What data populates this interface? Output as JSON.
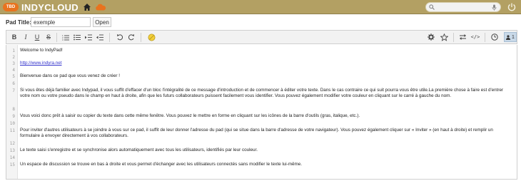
{
  "app": {
    "logo_badge": "TBD",
    "logo_text": "INDYCLOUD",
    "brand_color": "#b3a063",
    "accent_color": "#e8731e"
  },
  "search": {
    "placeholder": ""
  },
  "pad": {
    "title_label": "Pad Title:",
    "title_value": "exemple",
    "open_label": "Open"
  },
  "toolbar": {
    "left_buttons": [
      "bold-icon",
      "italic-icon",
      "underline-icon",
      "strikethrough-icon",
      "ordered-list-icon",
      "unordered-list-icon",
      "indent-icon",
      "outdent-icon",
      "undo-icon",
      "redo-icon",
      "clear-authorship-icon"
    ],
    "right_buttons": [
      "settings-icon",
      "star-icon",
      "import-export-icon",
      "embed-icon",
      "history-icon"
    ],
    "users_count": "1"
  },
  "editor": {
    "lines": [
      {
        "num": "1",
        "text": "Welcome to IndyPad!"
      },
      {
        "num": "2",
        "text": ""
      },
      {
        "num": "3",
        "text": "http://www.indyra.net",
        "link": true
      },
      {
        "num": "4",
        "text": ""
      },
      {
        "num": "5",
        "text": "Bienvenue dans ce pad que vous venez de créer !"
      },
      {
        "num": "6",
        "text": ""
      },
      {
        "num": "7",
        "text": "Si vous êtes déjà familier avec Indypad, il vous suffit d'effacer d'un bloc l'intégralité de ce message d'introduction et de commencer à éditer votre texte. Dans le cas contraire ce qui suit pourra vous être utile.La première chose à faire est d'entrer votre nom ou votre pseudo dans le champ en haut à droite, afin que les futurs collaborateurs puissent facilement vous identifier. Vous pouvez également modifier votre couleur en cliquant sur le carré à gauche du nom."
      },
      {
        "num": "8",
        "text": ""
      },
      {
        "num": "9",
        "text": "Vous voici donc prêt à saisir ou copier du texte dans cette même fenêtre. Vous pouvez le mettre en forme en cliquant sur les icônes de la barre d'outils (gras, italique, etc.)."
      },
      {
        "num": "10",
        "text": ""
      },
      {
        "num": "11",
        "text": "Pour inviter d'autres utilisateurs à se joindre à vous sur ce pad, il suffit de leur donner l'adresse du pad (qui se situe dans la barre d'adresse de votre navigateur). Vous pouvez également cliquer sur « Inviter » (en haut à droite) et remplir un formulaire à envoyer directement à vos collaborateurs."
      },
      {
        "num": "12",
        "text": ""
      },
      {
        "num": "13",
        "text": "Le texte saisi s'enregistre et se synchronise alors automatiquement avec tous les utilisateurs, identifiés par leur couleur."
      },
      {
        "num": "14",
        "text": ""
      },
      {
        "num": "15",
        "text": "Un espace de discussion se trouve en bas à droite et vous permet d'échanger avec les utilisateurs connectés sans modifier le texte lui-même."
      }
    ]
  }
}
